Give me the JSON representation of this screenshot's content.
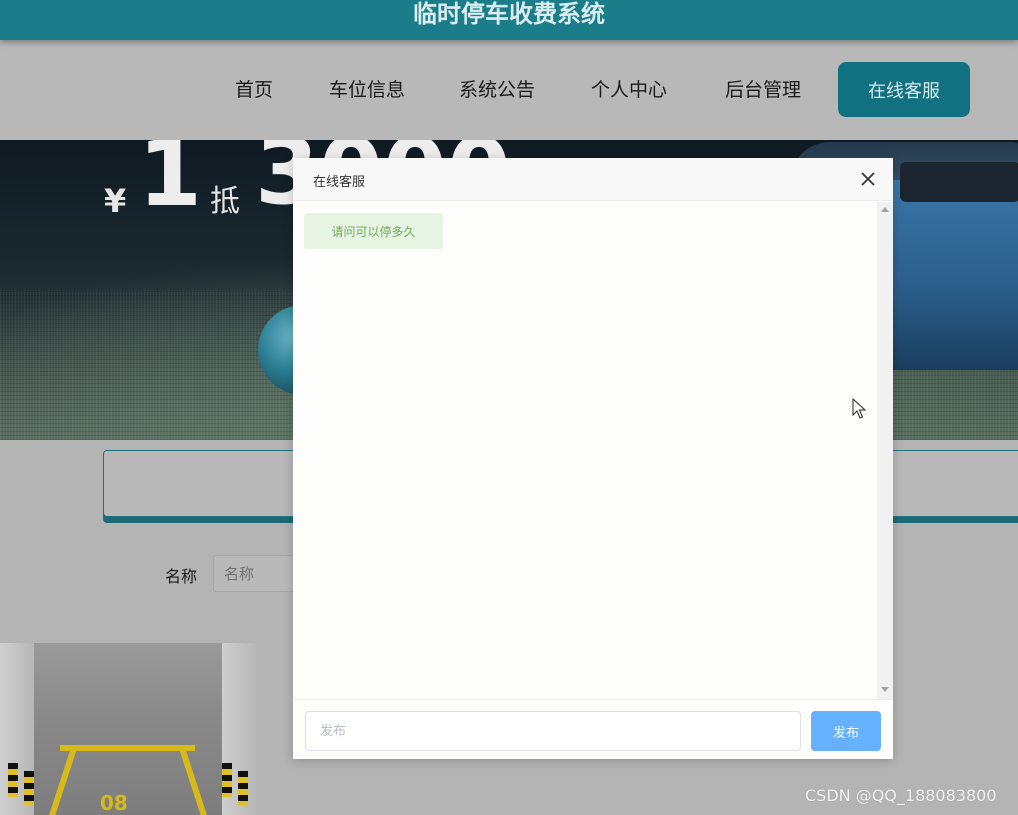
{
  "app": {
    "title": "临时停车收费系统"
  },
  "nav": {
    "items": [
      {
        "label": "首页"
      },
      {
        "label": "车位信息"
      },
      {
        "label": "系统公告"
      },
      {
        "label": "个人中心"
      },
      {
        "label": "后台管理"
      }
    ],
    "service_button": "在线客服"
  },
  "banner": {
    "currency": "¥",
    "amount": "1",
    "deduct": "抵",
    "amount2": "3000"
  },
  "filter": {
    "label": "名称",
    "placeholder": "名称"
  },
  "parking_card": {
    "spot_number": "08"
  },
  "chat_dialog": {
    "title": "在线客服",
    "messages": [
      {
        "text": "请问可以停多久"
      }
    ],
    "input_placeholder": "发布",
    "send_label": "发布"
  },
  "watermark": "CSDN @QQ_188083800",
  "colors": {
    "primary": "#1b7d8a",
    "service_button": "#127180",
    "send_button": "#66b1ff",
    "bubble_bg": "#e7f3e3",
    "bubble_text": "#6cae55"
  }
}
